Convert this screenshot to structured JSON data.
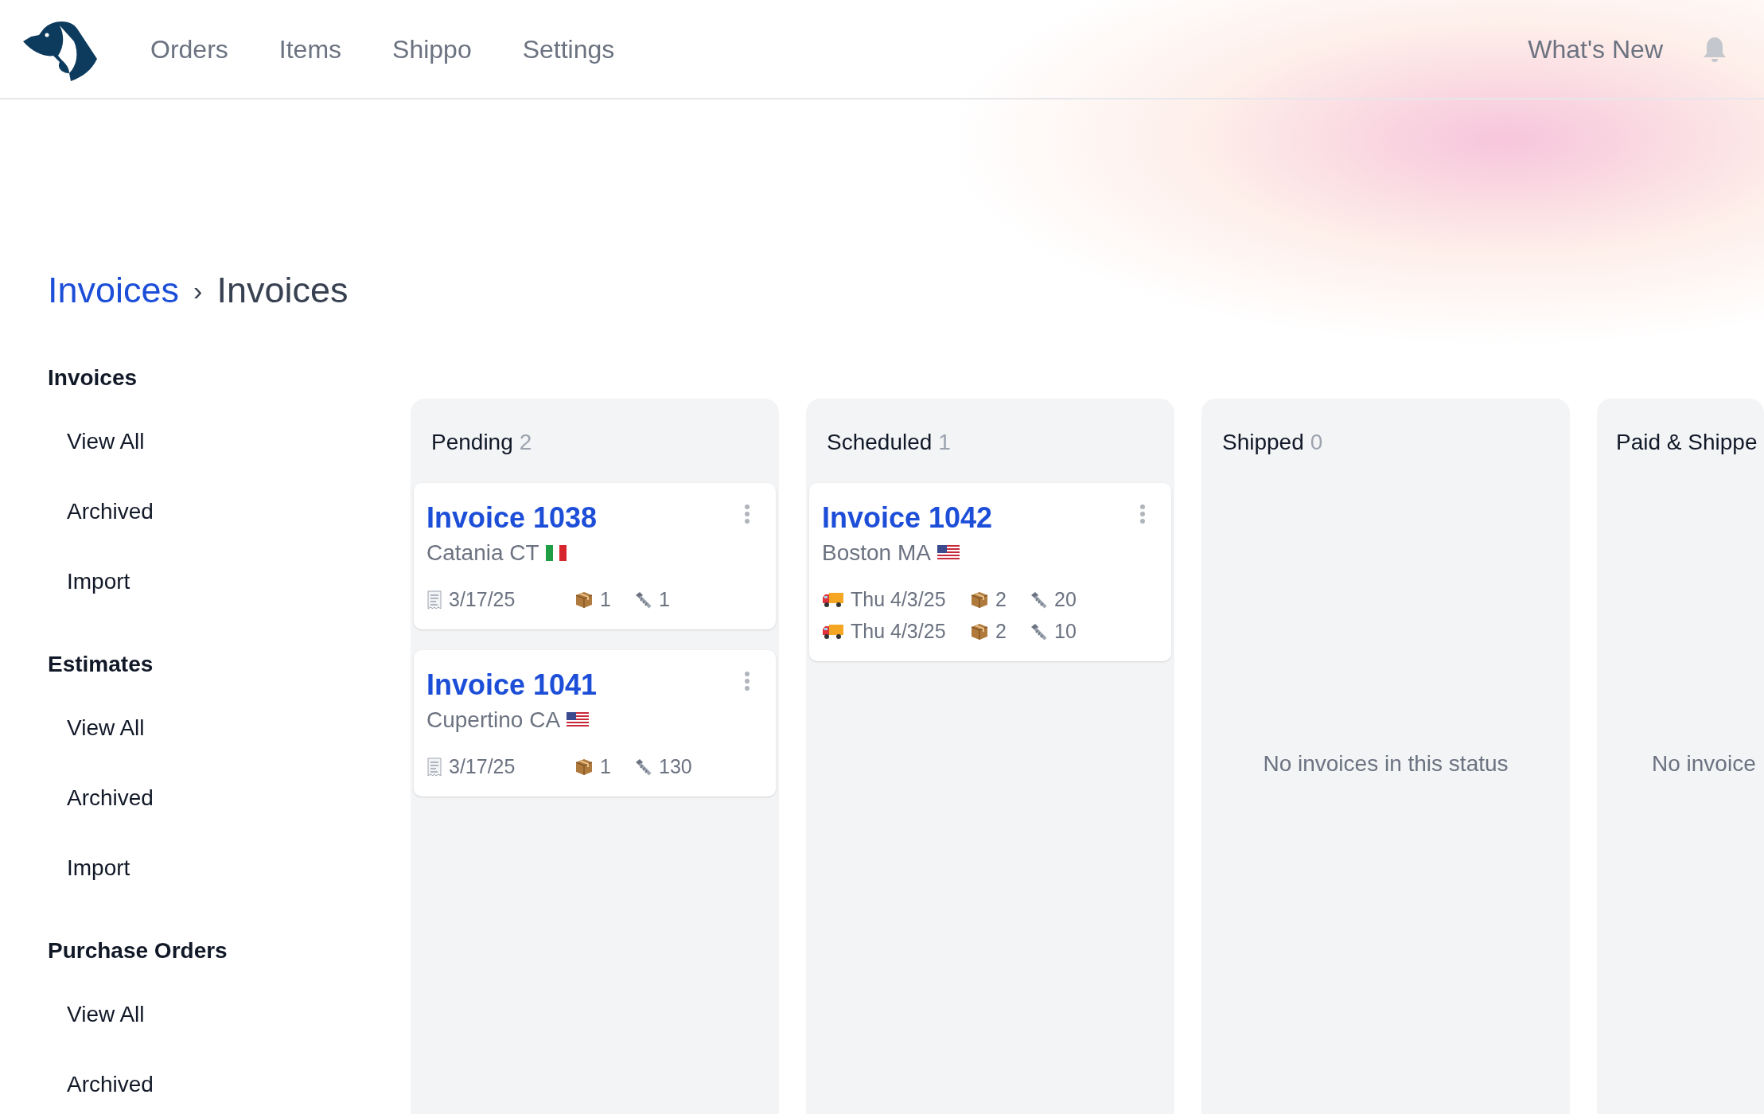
{
  "nav": {
    "links": [
      "Orders",
      "Items",
      "Shippo",
      "Settings"
    ],
    "whats_new": "What's New"
  },
  "breadcrumb": {
    "parent": "Invoices",
    "separator": "›",
    "current": "Invoices"
  },
  "sidebar": [
    {
      "heading": "Invoices",
      "items": [
        "View All",
        "Archived",
        "Import"
      ]
    },
    {
      "heading": "Estimates",
      "items": [
        "View All",
        "Archived",
        "Import"
      ]
    },
    {
      "heading": "Purchase Orders",
      "items": [
        "View All",
        "Archived"
      ]
    }
  ],
  "board": [
    {
      "title": "Pending",
      "count": "2",
      "cards": [
        {
          "title": "Invoice 1038",
          "location": "Catania CT",
          "flag": {
            "kind": "it"
          },
          "lines": [
            {
              "kind": "invoiced",
              "date": "3/17/25",
              "boxes": "1",
              "items": "1"
            }
          ]
        },
        {
          "title": "Invoice 1041",
          "location": "Cupertino CA",
          "flag": {
            "kind": "us"
          },
          "lines": [
            {
              "kind": "invoiced",
              "date": "3/17/25",
              "boxes": "1",
              "items": "130"
            }
          ]
        }
      ]
    },
    {
      "title": "Scheduled",
      "count": "1",
      "cards": [
        {
          "title": "Invoice 1042",
          "location": "Boston MA",
          "flag": {
            "kind": "us"
          },
          "lines": [
            {
              "kind": "shipping",
              "date": "Thu 4/3/25",
              "boxes": "2",
              "items": "20"
            },
            {
              "kind": "shipping",
              "date": "Thu 4/3/25",
              "boxes": "2",
              "items": "10"
            }
          ]
        }
      ]
    },
    {
      "title": "Shipped",
      "count": "0",
      "empty_text": "No invoices in this status"
    },
    {
      "title": "Paid & Shippe",
      "empty_text": "No invoice"
    }
  ]
}
